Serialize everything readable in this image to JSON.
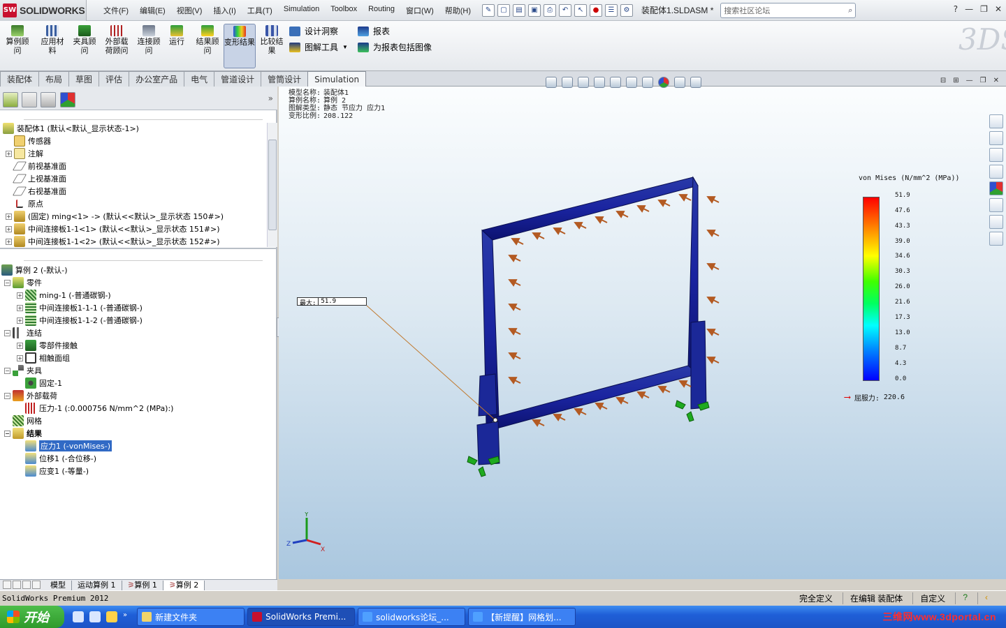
{
  "app": {
    "brand": "SOLIDWORKS",
    "logo_letters": "SW",
    "document": "装配体1.SLDASM *"
  },
  "menu": [
    "文件(F)",
    "编辑(E)",
    "视图(V)",
    "插入(I)",
    "工具(T)",
    "Simulation",
    "Toolbox",
    "Routing",
    "窗口(W)",
    "帮助(H)"
  ],
  "search": {
    "placeholder": "搜索社区论坛"
  },
  "commands": {
    "study_advisor": "算例顾问",
    "apply_material": "应用材料",
    "fixtures": "夹具顾问",
    "loads": "外部载荷顾问",
    "connections": "连接顾问",
    "run": "运行",
    "results_advisor": "结果顾问",
    "deformed_result": "变形结果",
    "compare_results": "比较结果",
    "design_insight": "设计洞察",
    "plot_tools": "图解工具",
    "report": "报表",
    "include_image": "为报表包括图像"
  },
  "tabs": [
    "装配体",
    "布局",
    "草图",
    "评估",
    "办公室产品",
    "电气",
    "管道设计",
    "管筒设计",
    "Simulation"
  ],
  "feature_tree": {
    "root": "装配体1  (默认<默认_显示状态-1>)",
    "items": [
      {
        "label": "传感器",
        "toggle": ""
      },
      {
        "label": "注解",
        "toggle": "+"
      },
      {
        "label": "前视基准面",
        "toggle": ""
      },
      {
        "label": "上视基准面",
        "toggle": ""
      },
      {
        "label": "右视基准面",
        "toggle": ""
      },
      {
        "label": "原点",
        "toggle": ""
      },
      {
        "label": "(固定) ming<1> -> (默认<<默认>_显示状态 150#>)",
        "toggle": "+"
      },
      {
        "label": "中间连接板1-1<1> (默认<<默认>_显示状态 151#>)",
        "toggle": "+"
      },
      {
        "label": "中间连接板1-1<2> (默认<<默认>_显示状态 152#>)",
        "toggle": "+"
      }
    ]
  },
  "study_tree": {
    "root": "算例 2 (-默认-)",
    "parts": "零件",
    "part_items": [
      "ming-1 (-普通碳钢-)",
      "中间连接板1-1-1 (-普通碳钢-)",
      "中间连接板1-1-2 (-普通碳钢-)"
    ],
    "connections": "连结",
    "connection_items": [
      "零部件接触",
      "相触面组"
    ],
    "fixtures": "夹具",
    "fixture_items": [
      "固定-1"
    ],
    "loads": "外部载荷",
    "load_items": [
      "压力-1 (:0.000756 N/mm^2 (MPa):)"
    ],
    "mesh": "网格",
    "results": "结果",
    "result_items": [
      "应力1 (-vonMises-)",
      "位移1 (-合位移-)",
      "应变1 (-等量-)"
    ]
  },
  "bottom_tabs": [
    "模型",
    "运动算例 1",
    "算例 1",
    "算例 2"
  ],
  "hud": {
    "model_label": "模型名称:",
    "model_value": "装配体1",
    "study_label": "算例名称:",
    "study_value": "算例 2",
    "plot_label": "图解类型:",
    "plot_value": "静态 节应力 应力1",
    "scale_label": "变形比例:",
    "scale_value": "208.122"
  },
  "legend": {
    "title": "von Mises (N/mm^2 (MPa))",
    "ticks": [
      "51.9",
      "47.6",
      "43.3",
      "39.0",
      "34.6",
      "30.3",
      "26.0",
      "21.6",
      "17.3",
      "13.0",
      "8.7",
      "4.3",
      "0.0"
    ],
    "yield_label": "屈服力:",
    "yield_value": "220.6",
    "colors": {
      "max": "#ff0000",
      "min": "#0000ff",
      "yield_arrow": "#e00000"
    }
  },
  "max_probe": {
    "label": "最大:",
    "value": "51.9"
  },
  "triad": {
    "x": "X",
    "y": "Y",
    "z": "Z"
  },
  "status": {
    "left": "SolidWorks Premium 2012",
    "fully_defined": "完全定义",
    "editing": "在编辑 装配体",
    "custom": "自定义"
  },
  "taskbar": {
    "start": "开始",
    "tasks": [
      "新建文件夹",
      "SolidWorks Premi...",
      "solidworks论坛_...",
      "【新提醒】网格划..."
    ],
    "watermark": "三维网www.3dportal.cn"
  }
}
